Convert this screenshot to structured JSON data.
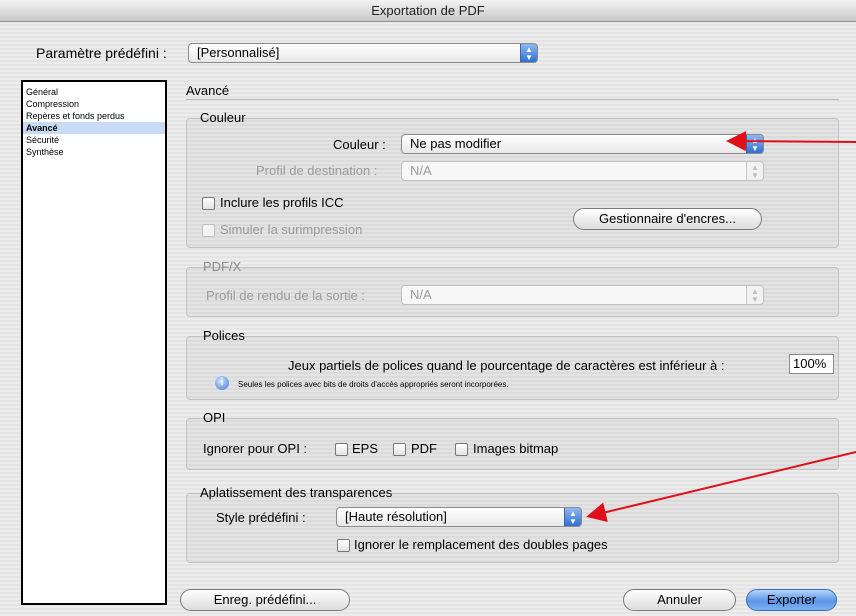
{
  "window": {
    "title": "Exportation de PDF"
  },
  "preset": {
    "label": "Paramètre prédéfini :",
    "value": "[Personnalisé]"
  },
  "sidebar": {
    "items": [
      {
        "label": "Général"
      },
      {
        "label": "Compression"
      },
      {
        "label": "Repères et fonds perdus"
      },
      {
        "label": "Avancé",
        "selected": true
      },
      {
        "label": "Sécurité"
      },
      {
        "label": "Synthèse"
      }
    ]
  },
  "panel": {
    "title": "Avancé"
  },
  "couleur": {
    "legend": "Couleur",
    "color_label": "Couleur :",
    "color_value": "Ne pas modifier",
    "profile_label": "Profil de destination :",
    "profile_value": "N/A",
    "include_icc": "Inclure les profils ICC",
    "simulate_overprint": "Simuler la surimpression",
    "ink_manager": "Gestionnaire d'encres..."
  },
  "pdfx": {
    "legend": "PDF/X",
    "output_label": "Profil de rendu de la sortie :",
    "output_value": "N/A"
  },
  "polices": {
    "legend": "Polices",
    "subset_label": "Jeux partiels de polices quand le pourcentage de caractères est inférieur à :",
    "subset_value": "100%",
    "info_text": "Seules les polices avec bits de droits d'accès appropriés seront incorporées."
  },
  "opi": {
    "legend": "OPI",
    "ignore_label": "Ignorer pour OPI :",
    "options": [
      "EPS",
      "PDF",
      "Images bitmap"
    ]
  },
  "transparence": {
    "legend": "Aplatissement des transparences",
    "style_label": "Style prédéfini :",
    "style_value": "[Haute résolution]",
    "ignore_spread": "Ignorer le remplacement des doubles pages"
  },
  "buttons": {
    "save_preset": "Enreg. prédéfini...",
    "cancel": "Annuler",
    "export": "Exporter"
  },
  "colors": {
    "accent": "#2f6fd0",
    "annotation_arrow": "#e0101a"
  }
}
